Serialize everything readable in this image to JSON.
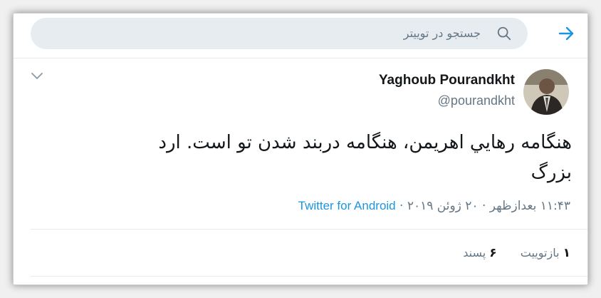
{
  "search": {
    "placeholder": "جستجو در توییتر"
  },
  "tweet": {
    "author_name": "Yaghoub Pourandkht",
    "author_handle": "@pourandkht",
    "text_line1": "هنگامه رهايي اهريمن، هنگامه دربند شدن تو است. ارد",
    "text_line2": "بزرگ",
    "time": "۱۱:۴۳ بعدازظهر",
    "date": "۲۰ ژوئن ۲۰۱۹",
    "separator": "·",
    "source": "Twitter for Android"
  },
  "stats": {
    "retweets_count": "۱",
    "retweets_label": "بازتوییت",
    "likes_count": "۶",
    "likes_label": "پسند"
  },
  "colors": {
    "accent": "#1b95e0",
    "muted": "#657786",
    "text": "#14171a",
    "search_bg": "#e6ecf0"
  },
  "icons": [
    "back-arrow-icon",
    "search-icon",
    "chevron-down-icon"
  ]
}
